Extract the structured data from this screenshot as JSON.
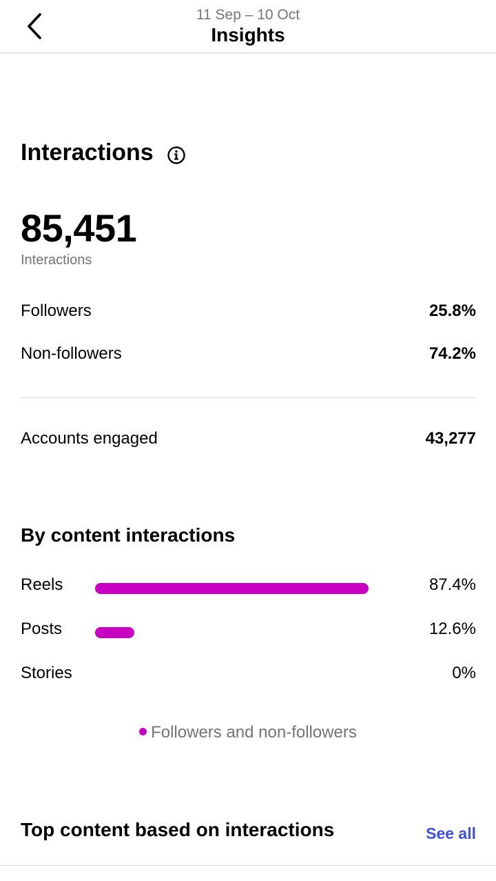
{
  "header": {
    "date_range": "11 Sep – 10 Oct",
    "title": "Insights"
  },
  "interactions": {
    "title": "Interactions",
    "total": "85,451",
    "total_caption": "Interactions",
    "breakdown": [
      {
        "label": "Followers",
        "value": "25.8%"
      },
      {
        "label": "Non-followers",
        "value": "74.2%"
      }
    ],
    "accounts_engaged": {
      "label": "Accounts engaged",
      "value": "43,277"
    }
  },
  "by_content": {
    "title": "By content interactions",
    "accent_color": "#c800c0",
    "items": [
      {
        "label": "Reels",
        "value": "87.4%",
        "fraction": 0.874
      },
      {
        "label": "Posts",
        "value": "12.6%",
        "fraction": 0.126
      },
      {
        "label": "Stories",
        "value": "0%",
        "fraction": 0
      }
    ],
    "legend": "Followers and non-followers"
  },
  "top_content": {
    "title": "Top content based on interactions",
    "see_all": "See all",
    "link_color": "#3f51d6"
  },
  "icons": {
    "back": "chevron-left-icon",
    "info": "info-circle-icon"
  }
}
